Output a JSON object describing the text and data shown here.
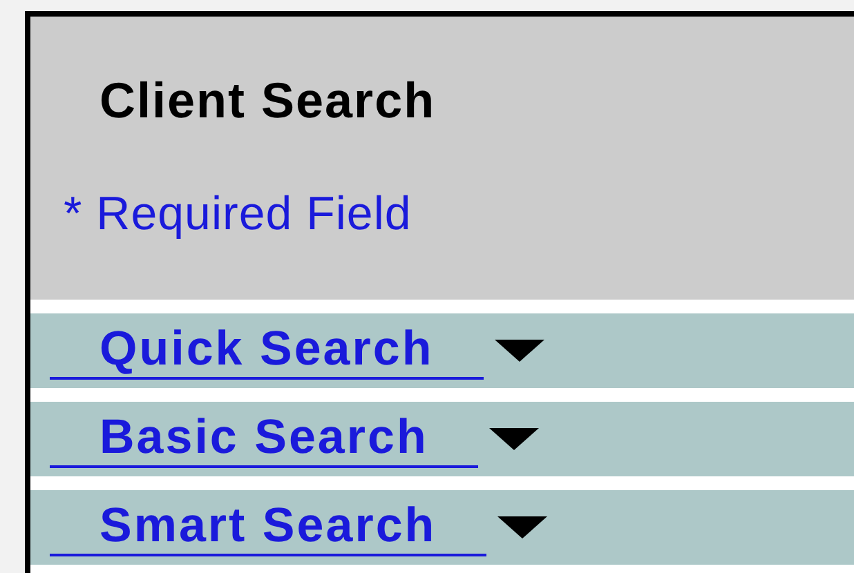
{
  "panel": {
    "title": "Client Search",
    "note": "* Required Field"
  },
  "sections": [
    {
      "label": "Quick Search",
      "expanded": false
    },
    {
      "label": "Basic Search",
      "expanded": false
    },
    {
      "label": "Smart Search",
      "expanded": false
    }
  ]
}
